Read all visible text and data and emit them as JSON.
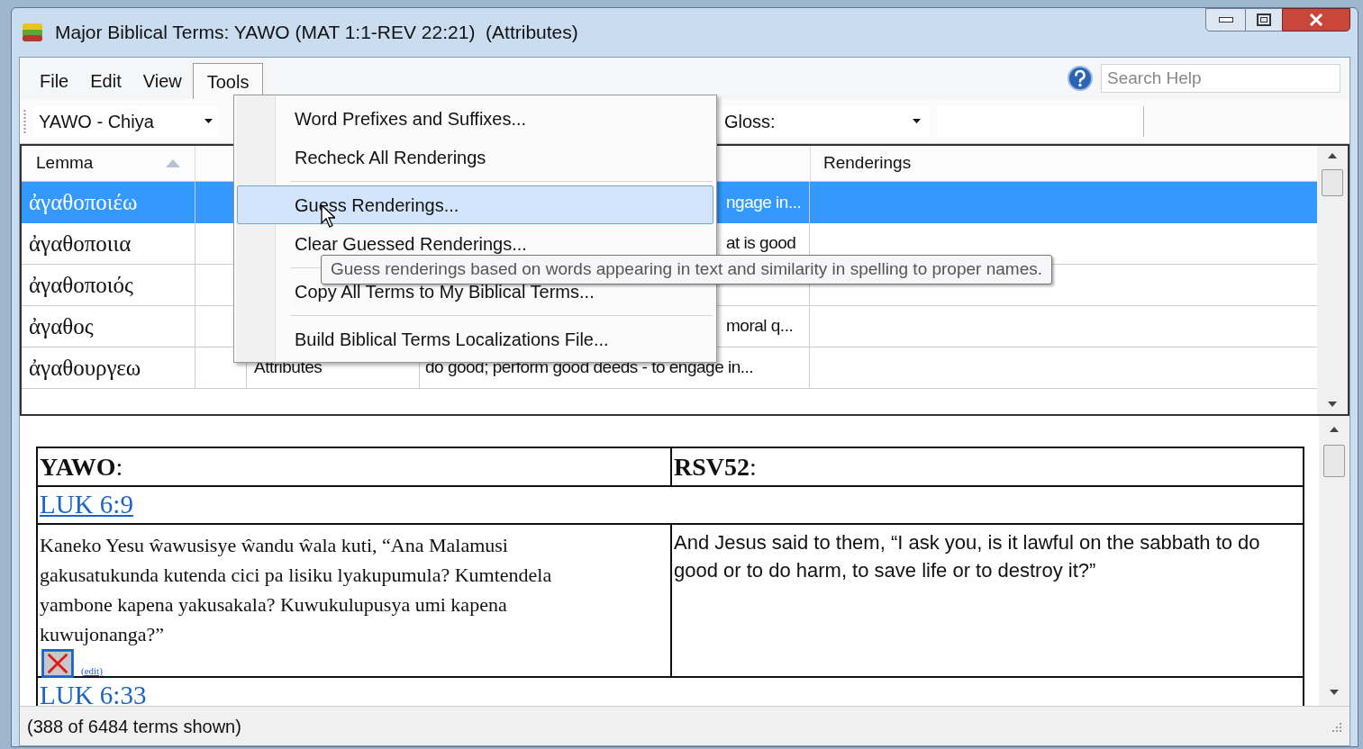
{
  "window": {
    "title": "Major Biblical Terms: YAWO (MAT 1:1-REV 22:21)  (Attributes)"
  },
  "menu_bar": [
    {
      "label": "File",
      "selected": false
    },
    {
      "label": "Edit",
      "selected": false
    },
    {
      "label": "View",
      "selected": false
    },
    {
      "label": "Tools",
      "selected": true
    }
  ],
  "help_search": {
    "placeholder": "Search Help"
  },
  "toolbar": {
    "project": "YAWO - Chiya",
    "gloss_label": "Gloss:"
  },
  "table": {
    "columns": [
      "Lemma",
      "Renderings"
    ],
    "rows": [
      {
        "lemma": "ἀγαθοποιέω",
        "gloss": "ngage in...",
        "selected": true
      },
      {
        "lemma": "ἀγαθοποιια",
        "gloss": "at is good",
        "selected": false
      },
      {
        "lemma": "ἀγαθοποιός",
        "selected": false
      },
      {
        "lemma": "ἀγαθος",
        "gloss": "moral q...",
        "selected": false
      },
      {
        "lemma": "ἀγαθουργεω",
        "category": "Attributes",
        "gloss": "do good; perform good deeds - to engage in...",
        "selected": false
      }
    ]
  },
  "tools_menu": [
    {
      "kind": "item",
      "label": "Word Prefixes and Suffixes...",
      "selected": false
    },
    {
      "kind": "item",
      "label": "Recheck All Renderings",
      "selected": false
    },
    {
      "kind": "separator"
    },
    {
      "kind": "item",
      "label": "Guess Renderings...",
      "selected": true
    },
    {
      "kind": "item",
      "label": "Clear Guessed Renderings...",
      "selected": false
    },
    {
      "kind": "separator"
    },
    {
      "kind": "item",
      "label": "Copy All Terms to My Biblical Terms...",
      "selected": false
    },
    {
      "kind": "separator"
    },
    {
      "kind": "item",
      "label": "Build Biblical Terms Localizations File...",
      "selected": false
    }
  ],
  "tooltip": "Guess renderings based on words appearing in text and similarity in spelling to proper names.",
  "detail": {
    "headers": [
      "**YAWO**:",
      "**RSV52**:"
    ],
    "passages": [
      {
        "reference": "LUK 6:9",
        "text": "Kaneko Yesu ŵawusisye ŵandu ŵala kuti, “Ana Malamusi gakusatukunda kutenda cici pa lisiku lyakupumula? Kumtendela yambone kapena yakusakala? Kuwukulupusya umi kapena kuwujonanga?”",
        "edit": "(edit)",
        "translation": "And Jesus said to them, “I ask you, is it lawful on the sabbath to do good or to do harm, to save life or to destroy it?”"
      },
      {
        "reference": "LUK 6:33"
      }
    ]
  },
  "status_bar": "(388 of 6484 terms shown)"
}
